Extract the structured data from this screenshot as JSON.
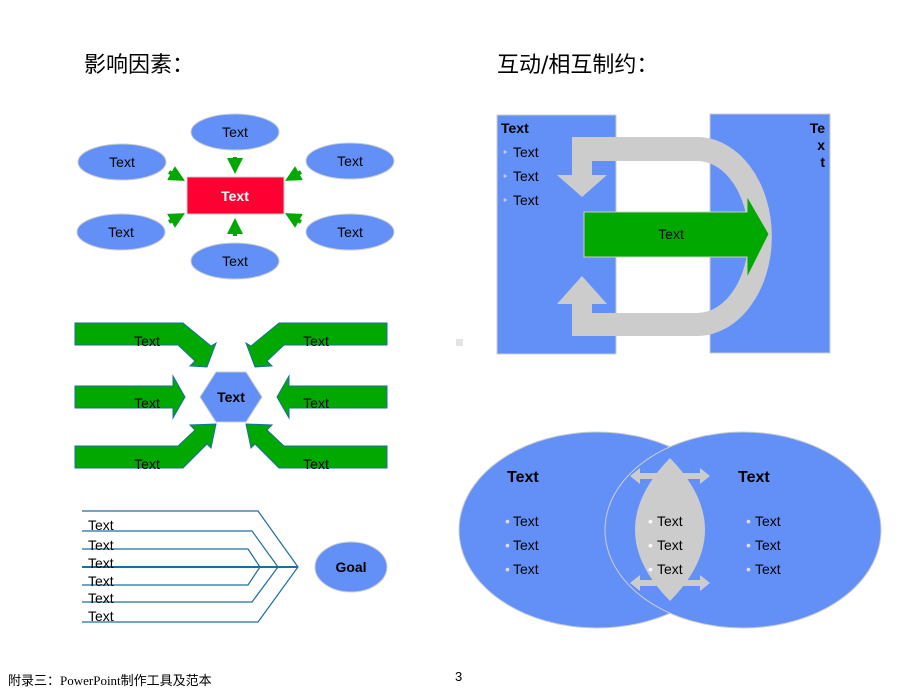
{
  "left_title": "影响因素：",
  "right_title": "互动/相互制约：",
  "influence_diagram": {
    "center": "Text",
    "satellites": [
      "Text",
      "Text",
      "Text",
      "Text",
      "Text",
      "Text"
    ]
  },
  "converge_diagram": {
    "center": "Text",
    "arrows": [
      "Text",
      "Text",
      "Text",
      "Text",
      "Text",
      "Text"
    ]
  },
  "goal_diagram": {
    "lines": [
      "Text",
      "Text",
      "Text",
      "Text",
      "Text",
      "Text"
    ],
    "goal": "Goal"
  },
  "interaction_diagram": {
    "left_title": "Text",
    "left_items": [
      "Text",
      "Text",
      "Text"
    ],
    "right_vertical": [
      "Te",
      "x",
      "t"
    ],
    "arrow_label": "Text"
  },
  "venn_diagram": {
    "left_title": "Text",
    "left_items": [
      "Text",
      "Text",
      "Text"
    ],
    "center_items": [
      "Text",
      "Text",
      "Text"
    ],
    "right_title": "Text",
    "right_items": [
      "Text",
      "Text",
      "Text"
    ]
  },
  "colors": {
    "blue": "#6290f6",
    "green": "#00a800",
    "red": "#ff0033",
    "grey": "#cccccc"
  },
  "footer": {
    "left": "附录三：PowerPoint制作工具及范本",
    "page": "3"
  }
}
